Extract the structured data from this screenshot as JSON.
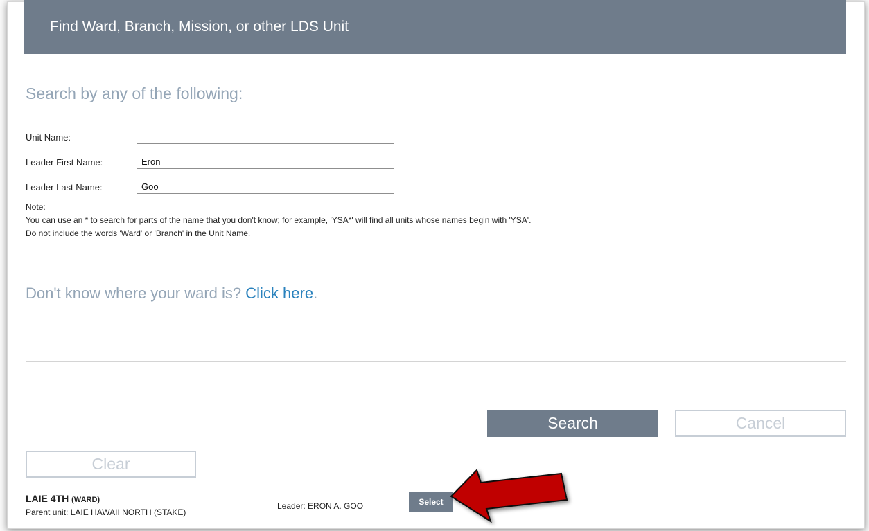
{
  "header": {
    "title": "Find Ward, Branch, Mission, or other LDS Unit"
  },
  "form": {
    "heading": "Search by any of the following:",
    "unit_name_label": "Unit Name:",
    "unit_name_value": "",
    "leader_first_label": "Leader First Name:",
    "leader_first_value": "Eron",
    "leader_last_label": "Leader Last Name:",
    "leader_last_value": "Goo"
  },
  "note": {
    "title": "Note:",
    "line1": "You can use an * to search for parts of the name that you don't know; for example, 'YSA*' will find all units whose names begin with 'YSA'.",
    "line2": "Do not include the words 'Ward' or 'Branch' in the Unit Name."
  },
  "help": {
    "prefix": "Don't know where your ward is?",
    "link": "Click here",
    "suffix": "."
  },
  "buttons": {
    "search": "Search",
    "cancel": "Cancel",
    "clear": "Clear"
  },
  "result": {
    "name": "LAIE 4TH",
    "type": "(WARD)",
    "parent": "Parent unit: LAIE HAWAII NORTH (STAKE)",
    "leader": "Leader: ERON A. GOO",
    "select_label": "Select"
  },
  "colors": {
    "header_bg": "#6f7c8b",
    "accent_link": "#2a82bd",
    "muted_text": "#94a5b6",
    "annotation_arrow": "#c00000"
  }
}
